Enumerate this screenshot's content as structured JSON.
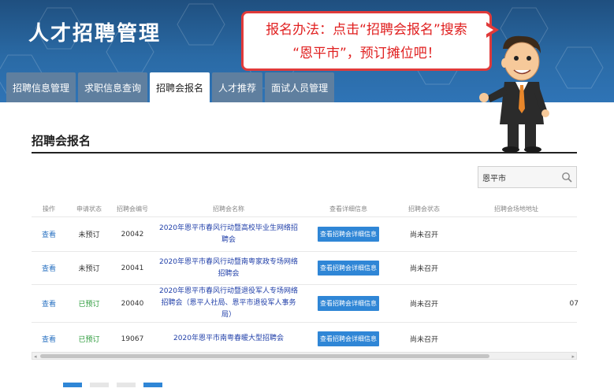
{
  "header": {
    "title": "人才招聘管理",
    "tabs": [
      {
        "label": "招聘信息管理",
        "active": false
      },
      {
        "label": "求职信息查询",
        "active": false
      },
      {
        "label": "招聘会报名",
        "active": true
      },
      {
        "label": "人才推荐",
        "active": false
      },
      {
        "label": "面试人员管理",
        "active": false
      }
    ]
  },
  "callout": {
    "line1": "报名办法：点击“招聘会报名”搜索",
    "line2": "“恩平市”，预订摊位吧！"
  },
  "main": {
    "section_title": "招聘会报名",
    "search": {
      "value": "恩平市"
    },
    "table": {
      "headers": [
        "操作",
        "申请状态",
        "招聘会编号",
        "招聘会名称",
        "查看详细信息",
        "招聘会状态",
        "招聘会场地地址"
      ],
      "rows": [
        {
          "op": "查看",
          "status": "未预订",
          "status_color": "#333333",
          "id": "20042",
          "name": "2020年恩平市春风行动暨高校毕业生网络招聘会",
          "detail": "查看招聘会详细信息",
          "meeting_status": "尚未召开",
          "address": ""
        },
        {
          "op": "查看",
          "status": "未预订",
          "status_color": "#333333",
          "id": "20041",
          "name": "2020年恩平市春风行动暨南粤家政专场网络招聘会",
          "detail": "查看招聘会详细信息",
          "meeting_status": "尚未召开",
          "address": ""
        },
        {
          "op": "查看",
          "status": "已预订",
          "status_color": "#2a9a3a",
          "id": "20040",
          "name": "2020年恩平市春风行动暨退役军人专场网络招聘会（恩平人社局、恩平市退役军人事务局）",
          "detail": "查看招聘会详细信息",
          "meeting_status": "尚未召开",
          "address": "07"
        },
        {
          "op": "查看",
          "status": "已预订",
          "status_color": "#2a9a3a",
          "id": "19067",
          "name": "2020年恩平市南粤春暖大型招聘会",
          "detail": "查看招聘会详细信息",
          "meeting_status": "尚未召开",
          "address": ""
        }
      ]
    }
  },
  "colors": {
    "header_blue": "#2a6aa5",
    "callout_red": "#e03a3a",
    "link_blue": "#2a72c2",
    "button_blue": "#2f86d6",
    "booked_green": "#2a9a3a"
  },
  "icons": {
    "search": "magnifier-icon"
  }
}
